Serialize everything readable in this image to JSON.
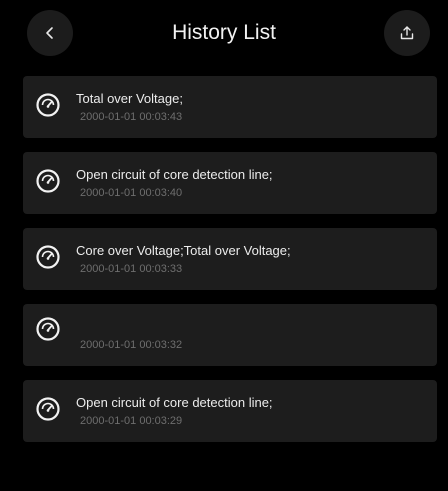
{
  "header": {
    "title": "History List",
    "back_icon": "chevron-left-icon",
    "export_icon": "share-upload-icon"
  },
  "history": [
    {
      "name": "Total over Voltage;",
      "time": "2000-01-01 00:03:43",
      "icon": "speedometer-icon"
    },
    {
      "name": "Open circuit of core detection line;",
      "time": "2000-01-01 00:03:40",
      "icon": "speedometer-icon"
    },
    {
      "name": "Core over Voltage;Total over Voltage;",
      "time": "2000-01-01 00:03:33",
      "icon": "speedometer-icon"
    },
    {
      "name": "",
      "time": "2000-01-01 00:03:32",
      "icon": "speedometer-icon"
    },
    {
      "name": "Open circuit of core detection line;",
      "time": "2000-01-01 00:03:29",
      "icon": "speedometer-icon"
    }
  ]
}
